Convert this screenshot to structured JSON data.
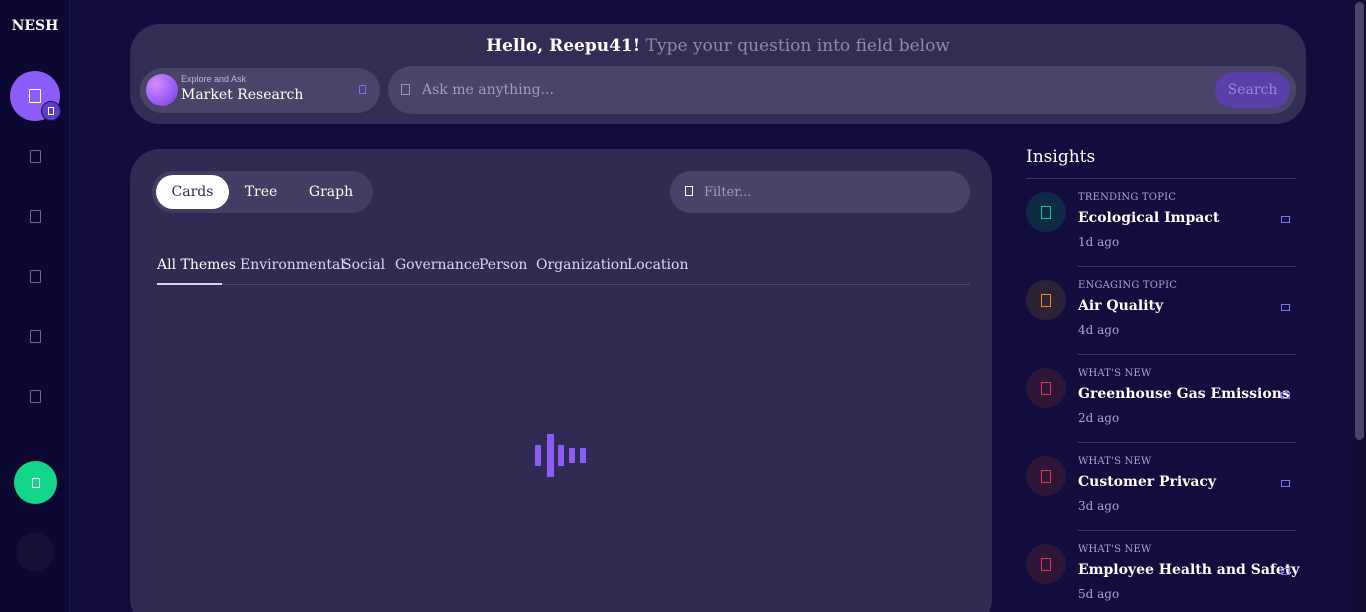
{
  "app": {
    "brand": "NESH"
  },
  "greeting": {
    "hello": "Hello, Reepu41!",
    "sub": "Type your question into field below"
  },
  "ask": {
    "mode_caption": "Explore and Ask",
    "mode_value": "Market Research",
    "search_placeholder": "Ask me anything...",
    "search_button": "Search"
  },
  "view_toggle": {
    "options": [
      "Cards",
      "Tree",
      "Graph"
    ],
    "selected": "Cards"
  },
  "filter": {
    "placeholder": "Filter..."
  },
  "themes": {
    "tabs": [
      "All Themes",
      "Environmental",
      "Social",
      "Governance",
      "Person",
      "Organization",
      "Location"
    ],
    "selected": "All Themes"
  },
  "insights": {
    "title": "Insights",
    "items": [
      {
        "kind": "TRENDING TOPIC",
        "topic": "Ecological Impact",
        "time": "1d ago",
        "accent": "#10c98a",
        "bg": "#0f2a45"
      },
      {
        "kind": "ENGAGING TOPIC",
        "topic": "Air Quality",
        "time": "4d ago",
        "accent": "#e8891f",
        "bg": "#2c2236"
      },
      {
        "kind": "WHAT'S NEW",
        "topic": "Greenhouse Gas Emissions",
        "time": "2d ago",
        "accent": "#e0344a",
        "bg": "#2e1638"
      },
      {
        "kind": "WHAT'S NEW",
        "topic": "Customer Privacy",
        "time": "3d ago",
        "accent": "#e0344a",
        "bg": "#2e1638"
      },
      {
        "kind": "WHAT'S NEW",
        "topic": "Employee Health and Safety",
        "time": "5d ago",
        "accent": "#e0344a",
        "bg": "#2e1638"
      }
    ]
  },
  "icons": {
    "nav": [
      "home-icon",
      "document-icon",
      "list-icon",
      "bookmark-icon",
      "folder-icon",
      "settings-icon"
    ],
    "loader": "loading-bars-icon"
  },
  "colors": {
    "accent": "#8b5cf6",
    "panel": "#322d55",
    "background": "#120d3d",
    "green": "#12d68a"
  }
}
